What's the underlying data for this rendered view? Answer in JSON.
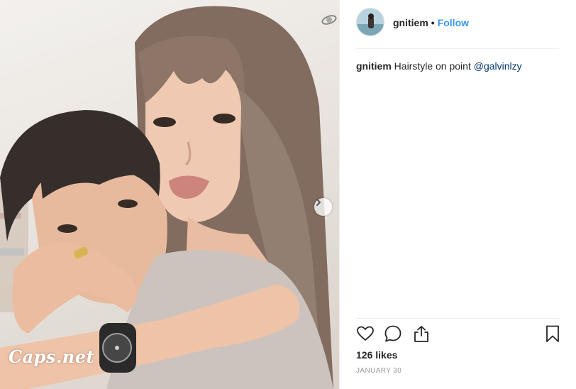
{
  "post": {
    "username": "gnitiem",
    "separator": "•",
    "follow_label": "Follow",
    "caption": {
      "username": "gnitiem",
      "text": "Hairstyle on point",
      "mention": "@galvinlzy"
    },
    "likes_text": "126 likes",
    "date": "JANUARY 30"
  },
  "media": {
    "watermark": "Caps.net"
  },
  "icons": {
    "like": "heart-icon",
    "comment": "comment-icon",
    "share": "share-icon",
    "save": "bookmark-icon",
    "next": "chevron-right-icon"
  },
  "colors": {
    "follow": "#3897f0",
    "mention": "#003569",
    "date": "#999999"
  }
}
